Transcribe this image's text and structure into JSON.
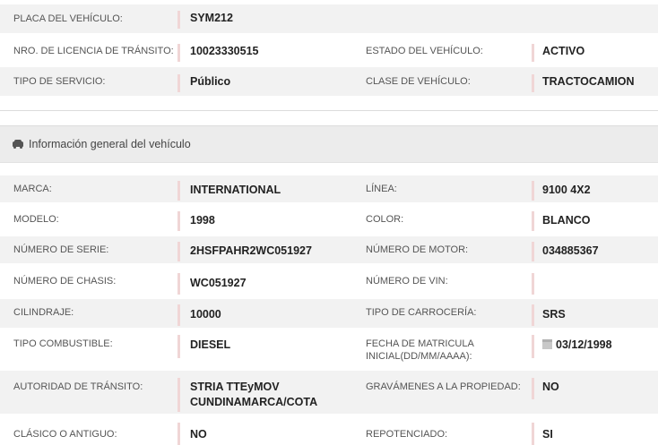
{
  "summary": {
    "placa_label": "PLACA DEL VEHÍCULO:",
    "placa_value": "SYM212",
    "licencia_label": "NRO. DE LICENCIA DE TRÁNSITO:",
    "licencia_value": "10023330515",
    "estado_label": "ESTADO DEL VEHÍCULO:",
    "estado_value": "ACTIVO",
    "servicio_label": "TIPO DE SERVICIO:",
    "servicio_value": "Público",
    "clase_label": "CLASE DE VEHÍCULO:",
    "clase_value": "TRACTOCAMION"
  },
  "section": {
    "title": "Información general del vehículo",
    "icon": "car-icon"
  },
  "details": [
    {
      "l1": "MARCA:",
      "v1": "INTERNATIONAL",
      "l2": "LÍNEA:",
      "v2": "9100 4X2"
    },
    {
      "l1": "MODELO:",
      "v1": "1998",
      "l2": "COLOR:",
      "v2": "BLANCO"
    },
    {
      "l1": "NÚMERO DE SERIE:",
      "v1": "2HSFPAHR2WC051927",
      "l2": "NÚMERO DE MOTOR:",
      "v2": "034885367"
    },
    {
      "l1": "NÚMERO DE CHASIS:",
      "v1": "WC051927",
      "l2": "NÚMERO DE VIN:",
      "v2": ""
    },
    {
      "l1": "CILINDRAJE:",
      "v1": "10000",
      "l2": "TIPO DE CARROCERÍA:",
      "v2": "SRS"
    },
    {
      "l1": "TIPO COMBUSTIBLE:",
      "v1": "DIESEL",
      "l2a": "FECHA DE MATRICULA",
      "l2b": "INICIAL(DD/MM/AAAA):",
      "v2": "03/12/1998"
    },
    {
      "l1": "AUTORIDAD DE TRÁNSITO:",
      "v1a": "STRIA TTEyMOV",
      "v1b": "CUNDINAMARCA/COTA",
      "l2": "GRAVÁMENES A LA PROPIEDAD:",
      "v2": "NO"
    },
    {
      "l1": "CLÁSICO O ANTIGUO:",
      "v1": "NO",
      "l2": "REPOTENCIADO:",
      "v2": "SI"
    }
  ]
}
